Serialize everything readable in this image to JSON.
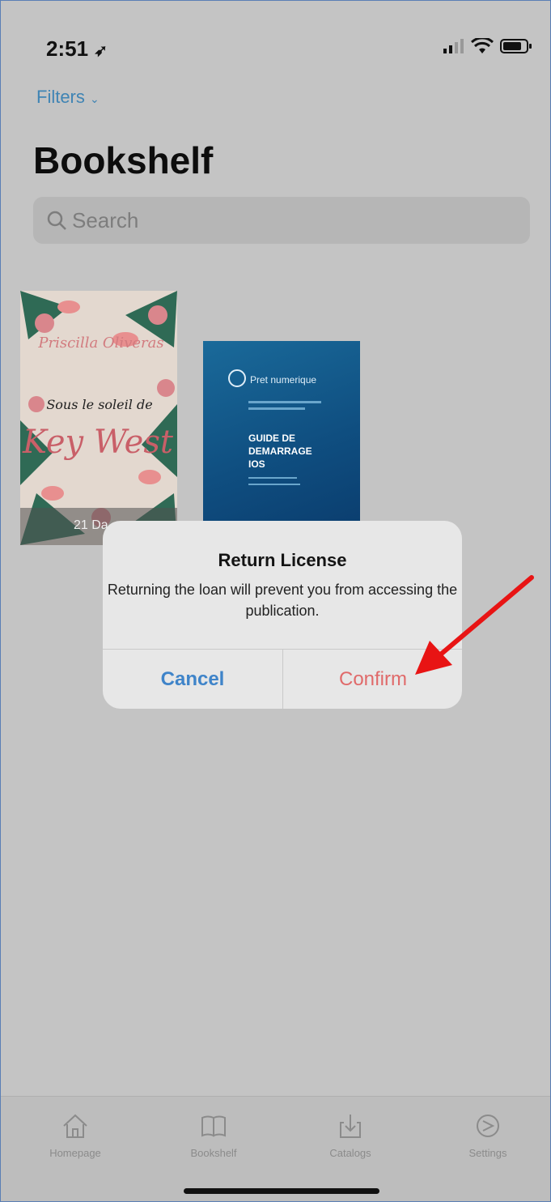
{
  "status_bar": {
    "time": "2:51"
  },
  "header": {
    "filters_label": "Filters",
    "title": "Bookshelf"
  },
  "search": {
    "placeholder": "Search"
  },
  "books": [
    {
      "cover_author": "Priscilla Oliveras",
      "cover_title_line1": "Sous le soleil de",
      "cover_title_line2": "Key West",
      "badge": "21 Da"
    },
    {
      "cover_brand": "Pret numerique",
      "cover_title": "GUIDE DE DEMARRAGE IOS"
    }
  ],
  "dialog": {
    "title": "Return License",
    "message": "Returning the loan will prevent you from accessing the publication.",
    "cancel_label": "Cancel",
    "confirm_label": "Confirm"
  },
  "tabbar": {
    "items": [
      {
        "label": "Homepage",
        "icon": "house-icon"
      },
      {
        "label": "Bookshelf",
        "icon": "book-icon"
      },
      {
        "label": "Catalogs",
        "icon": "download-tray-icon"
      },
      {
        "label": "Settings",
        "icon": "gauge-icon"
      }
    ]
  },
  "colors": {
    "accent_blue": "#3f84c9",
    "destructive": "#e06a6a",
    "annotation_arrow": "#e81414"
  }
}
